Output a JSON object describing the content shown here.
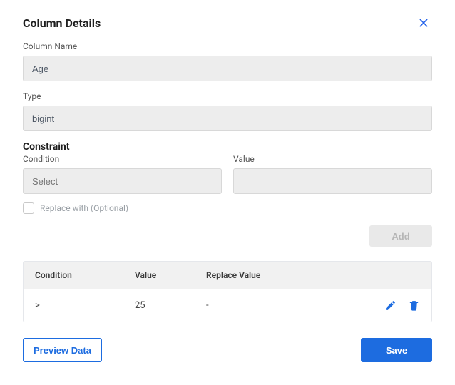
{
  "dialog": {
    "title": "Column Details"
  },
  "fields": {
    "column_name_label": "Column Name",
    "column_name_value": "Age",
    "type_label": "Type",
    "type_value": "bigint"
  },
  "constraint": {
    "section_title": "Constraint",
    "condition_label": "Condition",
    "condition_placeholder": "Select",
    "value_label": "Value",
    "value_value": "",
    "replace_with_label": "Replace with (Optional)",
    "add_label": "Add"
  },
  "table": {
    "headers": {
      "condition": "Condition",
      "value": "Value",
      "replace_value": "Replace Value"
    },
    "rows": [
      {
        "condition": ">",
        "value": "25",
        "replace_value": "-"
      }
    ]
  },
  "footer": {
    "preview_label": "Preview Data",
    "save_label": "Save"
  }
}
